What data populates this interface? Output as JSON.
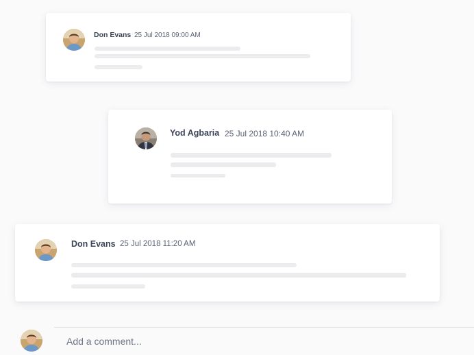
{
  "comments": [
    {
      "author": "Don Evans",
      "timestamp": "25 Jul 2018 09:00 AM",
      "avatar_icon": "user-avatar-icon"
    },
    {
      "author": "Yod Agbaria",
      "timestamp": "25 Jul 2018 10:40 AM",
      "avatar_icon": "user-avatar-icon"
    },
    {
      "author": "Don Evans",
      "timestamp": "25 Jul 2018 11:20 AM",
      "avatar_icon": "user-avatar-icon"
    }
  ],
  "composer": {
    "placeholder": "Add a comment...",
    "avatar_icon": "user-avatar-icon"
  },
  "colors": {
    "background": "#fafafb",
    "card": "#ffffff",
    "name_text": "#3b4557",
    "skeleton": "#ececee"
  }
}
